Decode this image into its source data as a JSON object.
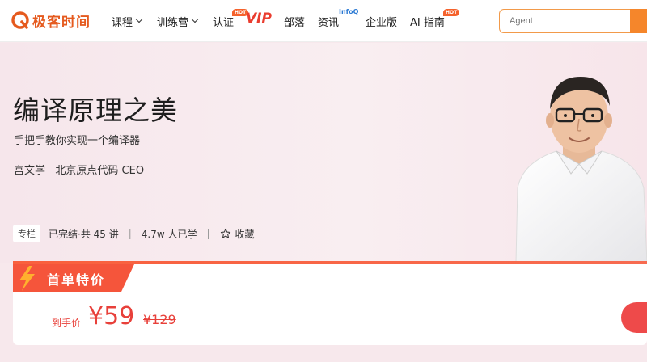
{
  "header": {
    "logo_text": "极客时间",
    "nav": [
      {
        "label": "课程"
      },
      {
        "label": "训练营"
      },
      {
        "label": "认证",
        "badge": "HOT"
      },
      {
        "label": "VIP"
      },
      {
        "label": "部落"
      },
      {
        "label": "资讯",
        "badge": "InfoQ"
      },
      {
        "label": "企业版"
      },
      {
        "label": "AI 指南",
        "badge": "HOT"
      }
    ],
    "search": {
      "placeholder": "Agent"
    }
  },
  "course": {
    "title": "编译原理之美",
    "subtitle": "手把手教你实现一个编译器",
    "author": "宫文学   北京原点代码 CEO",
    "tag": "专栏",
    "status": "已完结·共 45 讲",
    "learners": "4.7w 人已学",
    "favorite_label": "收藏",
    "separator": "|"
  },
  "pricing": {
    "promo_label": "首单特价",
    "prefix": "到手价",
    "price": "¥59",
    "original_price": "¥129"
  },
  "colors": {
    "accent": "#e8403a",
    "brand": "#e55a1e",
    "search_border": "#f29a4a"
  }
}
